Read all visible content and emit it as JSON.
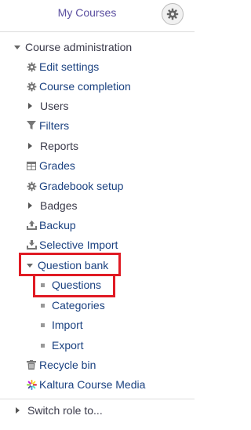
{
  "header": {
    "title": "My Courses",
    "settings_icon": "gear-icon"
  },
  "menu": {
    "section_label": "Course administration",
    "items": [
      {
        "label": "Edit settings",
        "icon": "gear-icon"
      },
      {
        "label": "Course completion",
        "icon": "gear-icon"
      },
      {
        "label": "Users",
        "icon": "caret-right-icon"
      },
      {
        "label": "Filters",
        "icon": "filter-icon"
      },
      {
        "label": "Reports",
        "icon": "caret-right-icon"
      },
      {
        "label": "Grades",
        "icon": "table-icon"
      },
      {
        "label": "Gradebook setup",
        "icon": "gear-icon"
      },
      {
        "label": "Badges",
        "icon": "caret-right-icon"
      },
      {
        "label": "Backup",
        "icon": "upload-icon"
      },
      {
        "label": "Selective Import",
        "icon": "download-icon"
      },
      {
        "label": "Question bank",
        "icon": "caret-down-icon",
        "highlighted": true
      },
      {
        "label": "Questions",
        "icon": "bullet-icon",
        "highlighted": true
      },
      {
        "label": "Categories",
        "icon": "bullet-icon"
      },
      {
        "label": "Import",
        "icon": "bullet-icon"
      },
      {
        "label": "Export",
        "icon": "bullet-icon"
      },
      {
        "label": "Recycle bin",
        "icon": "trash-icon"
      },
      {
        "label": "Kaltura Course Media",
        "icon": "kaltura-icon"
      }
    ],
    "switch_role_label": "Switch role to..."
  },
  "colors": {
    "link": "#1a4180",
    "highlight": "#e01b24",
    "title": "#5b4fa0"
  }
}
